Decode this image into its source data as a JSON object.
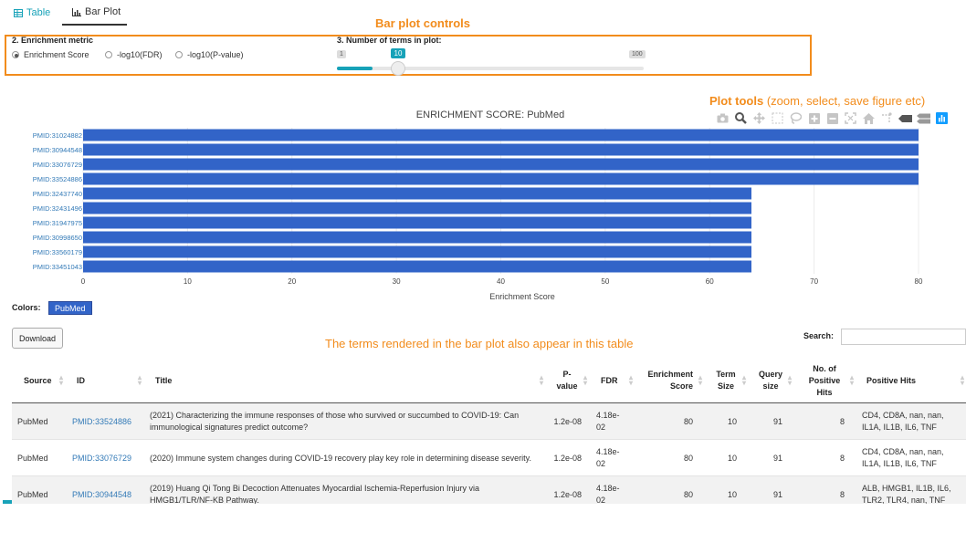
{
  "tabs": [
    {
      "label": "Table",
      "icon": "table-icon"
    },
    {
      "label": "Bar Plot",
      "icon": "bar-chart-icon"
    }
  ],
  "annotations": {
    "controls": "Bar plot controls",
    "plot_tools_bold": "Plot tools",
    "plot_tools_rest": " (zoom, select, save figure etc)",
    "table_note": "The terms rendered in the bar plot also appear in this table"
  },
  "controls": {
    "metric_label": "2. Enrichment metric",
    "metric_options": [
      "Enrichment Score",
      "-log10(FDR)",
      "-log10(P-value)"
    ],
    "metric_selected": "Enrichment Score",
    "terms_label": "3. Number of terms in plot:",
    "slider": {
      "min": "1",
      "max": "100",
      "value": "10",
      "value_num": 10,
      "min_num": 1,
      "max_num": 100
    }
  },
  "chart_data": {
    "type": "bar",
    "orientation": "horizontal",
    "title": "ENRICHMENT SCORE: PubMed",
    "xlabel": "Enrichment Score",
    "ylabel": "",
    "xlim": [
      0,
      80
    ],
    "xticks": [
      0,
      10,
      20,
      30,
      40,
      50,
      60,
      70,
      80
    ],
    "categories": [
      "PMID:31024882",
      "PMID:30944548",
      "PMID:33076729",
      "PMID:33524886",
      "PMID:32437740",
      "PMID:32431496",
      "PMID:31947975",
      "PMID:30998650",
      "PMID:33560179",
      "PMID:33451043"
    ],
    "values": [
      80,
      80,
      80,
      80,
      64,
      64,
      64,
      64,
      64,
      64
    ],
    "color": "#3264c8",
    "grid": true,
    "legend": "none"
  },
  "modebar_icons": [
    "camera-icon",
    "zoom-icon",
    "pan-icon",
    "box-select-icon",
    "lasso-icon",
    "zoom-in-icon",
    "zoom-out-icon",
    "autoscale-icon",
    "reset-axes-icon",
    "spike-lines-icon",
    "hover-closest-icon",
    "hover-compare-icon",
    "plotly-logo-icon"
  ],
  "colors_section": {
    "label": "Colors:",
    "chip": "PubMed",
    "chip_color": "#3264c8"
  },
  "download_label": "Download",
  "search": {
    "label": "Search:",
    "value": ""
  },
  "table": {
    "headers": [
      "Source",
      "ID",
      "Title",
      "P-value",
      "FDR",
      "Enrichment Score",
      "Term Size",
      "Query size",
      "No. of Positive Hits",
      "Positive Hits"
    ],
    "rows": [
      {
        "source": "PubMed",
        "id": "PMID:33524886",
        "title": "(2021) Characterizing the immune responses of those who survived or succumbed to COVID-19: Can immunological signatures predict outcome?",
        "pvalue": "1.2e-08",
        "fdr": "4.18e-02",
        "score": "80",
        "term_size": "10",
        "query_size": "91",
        "n_hits": "8",
        "hits": "CD4, CD8A, nan, nan, IL1A, IL1B, IL6, TNF"
      },
      {
        "source": "PubMed",
        "id": "PMID:33076729",
        "title": "(2020) Immune system changes during COVID-19 recovery play key role in determining disease severity.",
        "pvalue": "1.2e-08",
        "fdr": "4.18e-02",
        "score": "80",
        "term_size": "10",
        "query_size": "91",
        "n_hits": "8",
        "hits": "CD4, CD8A, nan, nan, IL1A, IL1B, IL6, TNF"
      },
      {
        "source": "PubMed",
        "id": "PMID:30944548",
        "title": "(2019) Huang Qi Tong Bi Decoction Attenuates Myocardial Ischemia-Reperfusion Injury via HMGB1/TLR/NF-KB Pathway.",
        "pvalue": "1.2e-08",
        "fdr": "4.18e-02",
        "score": "80",
        "term_size": "10",
        "query_size": "91",
        "n_hits": "8",
        "hits": "ALB, HMGB1, IL1B, IL6, TLR2, TLR4, nan, TNF"
      }
    ]
  }
}
